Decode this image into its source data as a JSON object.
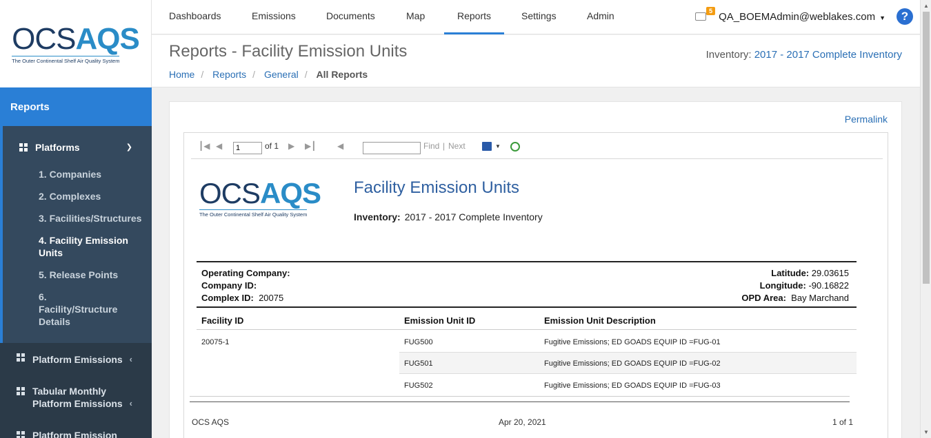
{
  "brand": {
    "logo_main_ocs": "OCS",
    "logo_main_aqs": "AQS",
    "logo_sub": "The Outer Continental Shelf Air Quality System"
  },
  "nav": {
    "items": [
      "Dashboards",
      "Emissions",
      "Documents",
      "Map",
      "Reports",
      "Settings",
      "Admin"
    ],
    "active": "Reports",
    "mail_count": "5",
    "user": "QA_BOEMAdmin@weblakes.com",
    "help": "?"
  },
  "sidebar": {
    "header": "Reports",
    "group_title": "Platforms",
    "subitems": [
      "1. Companies",
      "2. Complexes",
      "3. Facilities/Structures",
      "4. Facility Emission Units",
      "5. Release Points",
      "6. Facility/Structure Details"
    ],
    "active_subitem": "4. Facility Emission Units",
    "items": [
      "Platform Emissions",
      "Tabular Monthly Platform Emissions",
      "Platform Emission Manager"
    ]
  },
  "header": {
    "title": "Reports - Facility Emission Units",
    "breadcrumb": [
      "Home",
      "Reports",
      "General",
      "All Reports"
    ],
    "inventory_label": "Inventory:",
    "inventory_value": "2017 - 2017 Complete Inventory"
  },
  "content": {
    "permalink": "Permalink",
    "toolbar": {
      "page_value": "1",
      "of_label": "of 1",
      "find": "Find",
      "separator": "|",
      "next": "Next"
    },
    "report": {
      "title": "Facility Emission Units",
      "inventory_label": "Inventory:",
      "inventory_value": "2017 - 2017 Complete Inventory",
      "operating_company_label": "Operating Company:",
      "company_id_label": "Company ID:",
      "complex_id_label": "Complex ID:",
      "complex_id_value": "20075",
      "latitude_label": "Latitude:",
      "latitude_value": "29.03615",
      "longitude_label": "Longitude:",
      "longitude_value": "-90.16822",
      "opd_area_label": "OPD Area:",
      "opd_area_value": "Bay Marchand",
      "columns": [
        "Facility ID",
        "Emission Unit ID",
        "Emission Unit Description"
      ],
      "facility_id": "20075-1",
      "rows": [
        {
          "unit": "FUG500",
          "desc": "Fugitive Emissions; ED GOADS EQUIP ID =FUG-01"
        },
        {
          "unit": "FUG501",
          "desc": "Fugitive Emissions; ED GOADS EQUIP ID =FUG-02"
        },
        {
          "unit": "FUG502",
          "desc": "Fugitive Emissions; ED GOADS EQUIP ID =FUG-03"
        }
      ],
      "footer_left": "OCS AQS",
      "footer_center": "Apr 20, 2021",
      "footer_right": "1 of 1"
    }
  },
  "colors": {
    "accent": "#2a7fd6",
    "sidebar": "#2b3a48",
    "link": "#2a6fb5"
  }
}
